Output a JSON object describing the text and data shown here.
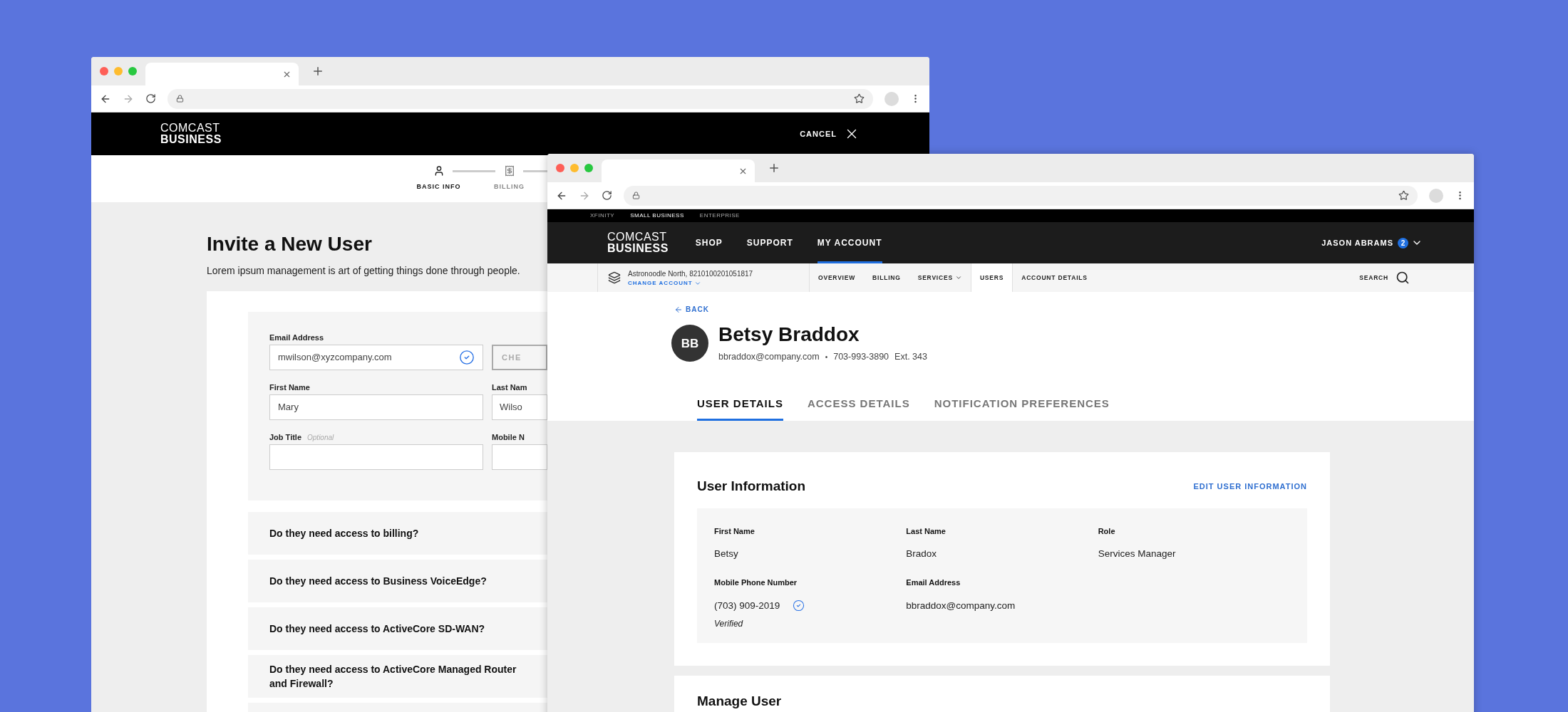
{
  "back_window": {
    "header": {
      "logo_top": "COMCAST",
      "logo_bottom": "BUSINESS",
      "cancel": "CANCEL"
    },
    "stepper": [
      {
        "label": "BASIC INFO",
        "selected": true,
        "kind": "person"
      },
      {
        "label": "BILLING",
        "selected": false,
        "kind": "receipt"
      }
    ],
    "title": "Invite a New User",
    "subtitle": "Lorem ipsum management is art of getting things done through people.",
    "fields": [
      {
        "label": "Email Address",
        "value": "mwilson@xyzcompany.com",
        "verified": true
      },
      {
        "label": "First Name",
        "value": "Mary",
        "verified": false
      },
      {
        "label": "Job Title",
        "optional": "Optional",
        "verified": false
      }
    ],
    "right_column": [
      {
        "kind": "button",
        "label": "CHE"
      },
      {
        "kind": "field",
        "label": "Last Nam",
        "value": "Wilso"
      },
      {
        "kind": "field",
        "label": "Mobile N"
      }
    ],
    "questions": [
      "Do they need access to billing?",
      "Do they need access to Business VoiceEdge?",
      "Do they need access to ActiveCore SD-WAN?",
      "Do they need access to ActiveCore Managed Router and Firewall?"
    ]
  },
  "front_window": {
    "top_links": [
      {
        "label": "XFINITY",
        "selected": false
      },
      {
        "label": "SMALL BUSINESS",
        "selected": true
      },
      {
        "label": "ENTERPRISE",
        "selected": false
      }
    ],
    "logo_top": "COMCAST",
    "logo_bottom": "BUSINESS",
    "nav": [
      {
        "label": "SHOP",
        "selected": false
      },
      {
        "label": "SUPPORT",
        "selected": false
      },
      {
        "label": "MY ACCOUNT",
        "selected": true
      }
    ],
    "user": {
      "name": "JASON ABRAMS",
      "badge": "2"
    },
    "account": {
      "name": "Astronoodle North, 8210100201051817",
      "change": "CHANGE ACCOUNT"
    },
    "subnav": [
      {
        "label": "OVERVIEW",
        "selected": false,
        "dropdown": false
      },
      {
        "label": "BILLING",
        "selected": false,
        "dropdown": false
      },
      {
        "label": "SERVICES",
        "selected": false,
        "dropdown": true
      },
      {
        "label": "USERS",
        "selected": true,
        "dropdown": false
      },
      {
        "label": "ACCOUNT DETAILS",
        "selected": false,
        "dropdown": false
      }
    ],
    "search": "SEARCH",
    "back": "BACK",
    "profile": {
      "initials": "BB",
      "name": "Betsy Braddox",
      "email": "bbraddox@company.com",
      "separator": "•",
      "phone": "703-993-3890",
      "ext": "Ext. 343"
    },
    "tabs": [
      {
        "label": "USER DETAILS",
        "selected": true
      },
      {
        "label": "ACCESS DETAILS",
        "selected": false
      },
      {
        "label": "NOTIFICATION PREFERENCES",
        "selected": false
      }
    ],
    "user_information": {
      "title": "User Information",
      "edit": "EDIT USER INFORMATION",
      "fields": [
        {
          "label": "First Name",
          "value": "Betsy",
          "verified": false
        },
        {
          "label": "Last Name",
          "value": "Bradox",
          "verified": false
        },
        {
          "label": "Role",
          "value": "Services Manager",
          "verified": false
        },
        {
          "label": "Mobile Phone Number",
          "value": "(703) 909-2019",
          "verified": true,
          "note": "Verified"
        },
        {
          "label": "Email Address",
          "value": "bbraddox@company.com",
          "verified": false
        }
      ]
    },
    "manage_user": {
      "title": "Manage User"
    }
  }
}
